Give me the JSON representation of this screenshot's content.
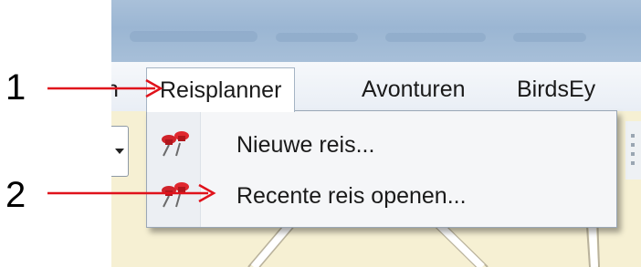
{
  "menubar": {
    "items": [
      {
        "label": "n"
      },
      {
        "label": "Reisplanner"
      },
      {
        "label": "Avonturen"
      },
      {
        "label": "BirdsEy"
      }
    ]
  },
  "dropdown": {
    "items": [
      {
        "label": "Nieuwe reis...",
        "icon": "pushpins-icon"
      },
      {
        "label": "Recente reis openen...",
        "icon": "pushpins-icon"
      }
    ]
  },
  "callouts": [
    {
      "number": "1"
    },
    {
      "number": "2"
    }
  ],
  "colors": {
    "arrow": "#e0121b",
    "titlebar": "#a9c0d9",
    "menubar": "#eef2f7",
    "map": "#f6f0d3"
  }
}
